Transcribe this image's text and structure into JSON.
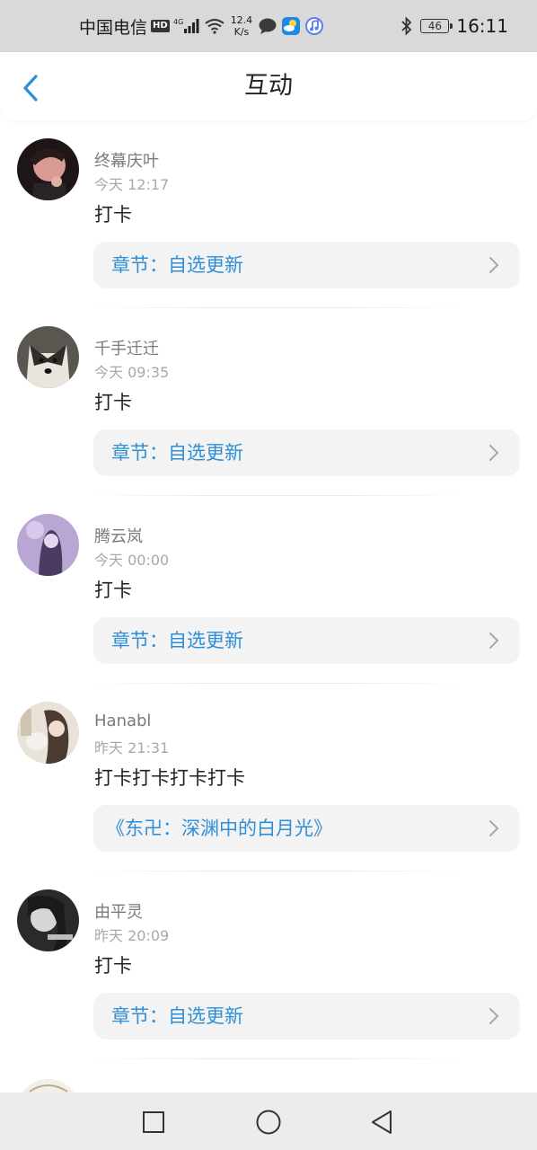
{
  "status_bar": {
    "carrier": "中国电信",
    "hd_badge": "HD",
    "network_type": "4G",
    "speed_value": "12.4",
    "speed_unit": "K/s",
    "battery": "46",
    "time": "16:11",
    "icons": [
      "hd-icon",
      "signal-icon",
      "wifi-icon",
      "chat-bubble-icon",
      "weather-icon",
      "music-icon",
      "bluetooth-icon",
      "battery-icon"
    ]
  },
  "header": {
    "title": "互动",
    "back_icon": "chevron-left-icon",
    "accent_color": "#2e8fd6"
  },
  "feed": [
    {
      "username": "终幕庆叶",
      "time": "今天 12:17",
      "comment": "打卡",
      "reference": "章节：自选更新",
      "avatar_colors": [
        "#3b2a2a",
        "#d9a0a0"
      ]
    },
    {
      "username": "千手迁迁",
      "time": "今天 09:35",
      "comment": "打卡",
      "reference": "章节：自选更新",
      "avatar_colors": [
        "#4a4a48",
        "#e8e4dc"
      ]
    },
    {
      "username": "腾云岚",
      "time": "今天 00:00",
      "comment": "打卡",
      "reference": "章节：自选更新",
      "avatar_colors": [
        "#6b5a86",
        "#c9b8e0"
      ]
    },
    {
      "username": "Hanabl",
      "time": "昨天 21:31",
      "comment": "打卡打卡打卡打卡",
      "reference": "《东卍：深渊中的白月光》",
      "avatar_colors": [
        "#d8cfc2",
        "#5a4a40"
      ]
    },
    {
      "username": "由平灵",
      "time": "昨天 20:09",
      "comment": "打卡",
      "reference": "章节：自选更新",
      "avatar_colors": [
        "#3a3a3a",
        "#cfcfcf"
      ]
    }
  ],
  "nav_bar": {
    "icons": [
      "recent-apps-icon",
      "home-icon",
      "back-icon"
    ]
  }
}
